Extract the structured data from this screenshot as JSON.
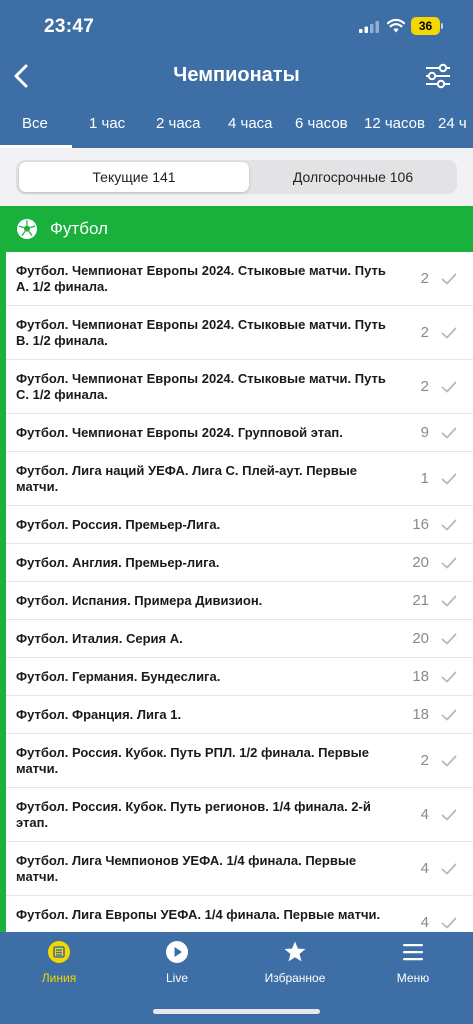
{
  "status_bar": {
    "time": "23:47",
    "battery": "36"
  },
  "header": {
    "title": "Чемпионаты"
  },
  "time_tabs": [
    "Все",
    "1 час",
    "2 часа",
    "4 часа",
    "6 часов",
    "12 часов",
    "24 ч"
  ],
  "segments": {
    "current": "Текущие 141",
    "long_term": "Долгосрочные 106"
  },
  "sport": {
    "name": "Футбол"
  },
  "championships": [
    {
      "title": "Футбол. Чемпионат Европы 2024. Стыковые матчи. Путь A. 1/2 финала.",
      "count": "2"
    },
    {
      "title": "Футбол. Чемпионат Европы 2024. Стыковые матчи. Путь B. 1/2 финала.",
      "count": "2"
    },
    {
      "title": "Футбол. Чемпионат Европы 2024. Стыковые матчи. Путь C. 1/2 финала.",
      "count": "2"
    },
    {
      "title": "Футбол. Чемпионат Европы 2024. Групповой этап.",
      "count": "9"
    },
    {
      "title": "Футбол. Лига наций УЕФА. Лига C. Плей-аут. Первые матчи.",
      "count": "1"
    },
    {
      "title": "Футбол. Россия. Премьер-Лига.",
      "count": "16"
    },
    {
      "title": "Футбол. Англия. Премьер-лига.",
      "count": "20"
    },
    {
      "title": "Футбол. Испания. Примера Дивизион.",
      "count": "21"
    },
    {
      "title": "Футбол. Италия. Серия А.",
      "count": "20"
    },
    {
      "title": "Футбол. Германия. Бундеслига.",
      "count": "18"
    },
    {
      "title": "Футбол. Франция. Лига 1.",
      "count": "18"
    },
    {
      "title": "Футбол. Россия. Кубок. Путь РПЛ. 1/2 финала. Первые матчи.",
      "count": "2"
    },
    {
      "title": "Футбол. Россия. Кубок. Путь регионов. 1/4 финала. 2-й этап.",
      "count": "4"
    },
    {
      "title": "Футбол. Лига Чемпионов УЕФА. 1/4 финала. Первые матчи.",
      "count": "4"
    },
    {
      "title": "Футбол. Лига Европы УЕФА. 1/4 финала. Первые матчи.",
      "count": "4"
    }
  ],
  "tabbar": {
    "line": "Линия",
    "live": "Live",
    "favorites": "Избранное",
    "menu": "Меню"
  },
  "colors": {
    "header": "#3d6fa6",
    "sport_green": "#19b13b",
    "active_tab": "#f4d600"
  },
  "icons": [
    "back-chevron-icon",
    "filter-sliders-icon",
    "soccer-ball-icon",
    "checkmark-icon",
    "line-icon",
    "live-play-icon",
    "star-icon",
    "menu-icon"
  ]
}
